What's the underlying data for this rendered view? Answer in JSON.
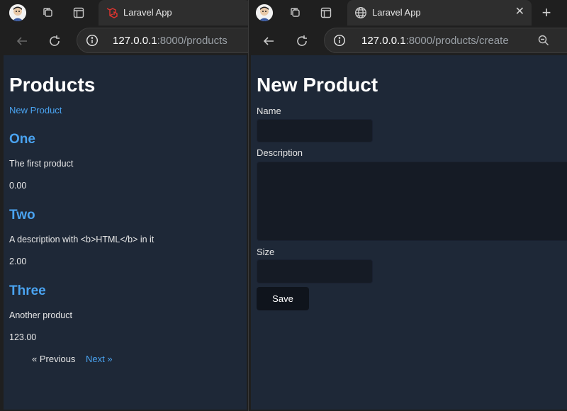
{
  "colors": {
    "page_bg": "#1e2837",
    "accent": "#4aa3f0",
    "chrome_bg": "#1f1f1f"
  },
  "left": {
    "tab": {
      "title": "Laravel App",
      "favicon": "laravel-icon"
    },
    "url": {
      "host": "127.0.0.1",
      "rest": ":8000/products"
    },
    "page": {
      "title": "Products",
      "new_link": "New Product",
      "products": [
        {
          "name": "One",
          "description": "The first product",
          "price": "0.00"
        },
        {
          "name": "Two",
          "description": "A description with <b>HTML</b> in it",
          "price": "2.00"
        },
        {
          "name": "Three",
          "description": "Another product",
          "price": "123.00"
        }
      ],
      "pagination": {
        "previous": "« Previous",
        "next": "Next »"
      }
    }
  },
  "right": {
    "tab": {
      "title": "Laravel App",
      "favicon": "globe-icon",
      "close": "✕"
    },
    "new_tab": "+",
    "url": {
      "host": "127.0.0.1",
      "rest": ":8000/products/create"
    },
    "page": {
      "title": "New Product",
      "name_label": "Name",
      "description_label": "Description",
      "size_label": "Size",
      "save_label": "Save"
    }
  }
}
